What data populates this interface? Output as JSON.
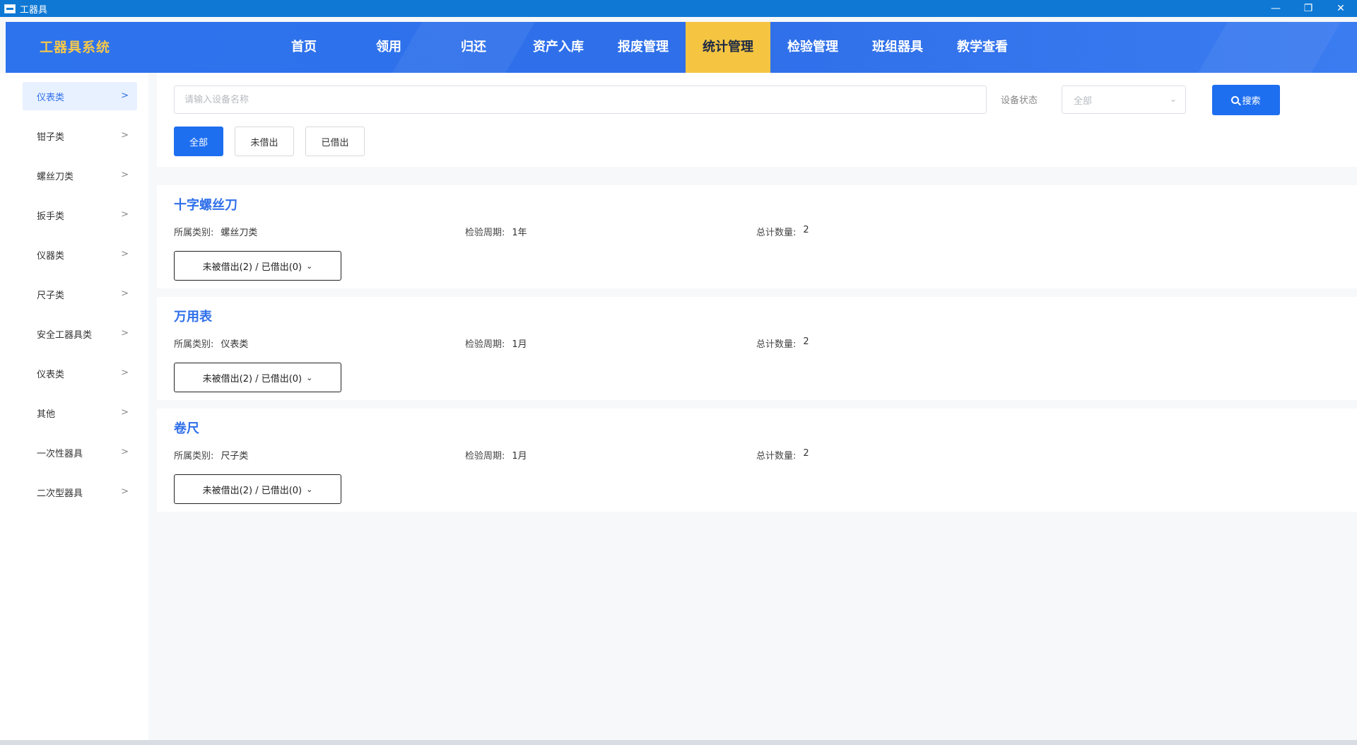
{
  "window": {
    "title": "工器具",
    "controls": [
      "minimize-icon",
      "restore-icon",
      "close-icon"
    ]
  },
  "navbar": {
    "brand": "工器具系统",
    "menu": [
      {
        "label": "首页"
      },
      {
        "label": "领用"
      },
      {
        "label": "归还"
      },
      {
        "label": "资产入库"
      },
      {
        "label": "报废管理"
      },
      {
        "label": "统计管理",
        "active": true
      },
      {
        "label": "检验管理"
      },
      {
        "label": "班组器具"
      },
      {
        "label": "教学查看"
      }
    ]
  },
  "sidebar": {
    "items": [
      {
        "label": "仪表类",
        "active": true
      },
      {
        "label": "钳子类"
      },
      {
        "label": "螺丝刀类"
      },
      {
        "label": "扳手类"
      },
      {
        "label": "仪器类"
      },
      {
        "label": "尺子类"
      },
      {
        "label": "安全工器具类"
      },
      {
        "label": "仪表类"
      },
      {
        "label": "其他"
      },
      {
        "label": "一次性器具"
      },
      {
        "label": "二次型器具"
      }
    ]
  },
  "filter": {
    "search_placeholder": "请输入设备名称",
    "search_value": "",
    "status_label": "设备状态",
    "status_value": "全部",
    "search_button": "搜索",
    "segments": [
      {
        "label": "全部",
        "active": true
      },
      {
        "label": "未借出"
      },
      {
        "label": "已借出"
      }
    ]
  },
  "cards": [
    {
      "title": "十字螺丝刀",
      "category_key": "所属类别:",
      "category_value": "螺丝刀类",
      "cycle_key": "检验周期:",
      "cycle_value": "1年",
      "count_key": "总计数量:",
      "count_value": "2",
      "dropdown": "未被借出(2) / 已借出(0)"
    },
    {
      "title": "万用表",
      "category_key": "所属类别:",
      "category_value": "仪表类",
      "cycle_key": "检验周期:",
      "cycle_value": "1月",
      "count_key": "总计数量:",
      "count_value": "2",
      "dropdown": "未被借出(2) / 已借出(0)"
    },
    {
      "title": "卷尺",
      "category_key": "所属类别:",
      "category_value": "尺子类",
      "cycle_key": "检验周期:",
      "cycle_value": "1月",
      "count_key": "总计数量:",
      "count_value": "2",
      "dropdown": "未被借出(2) / 已借出(0)"
    }
  ],
  "colors": {
    "primary": "#1e6ff0",
    "nav_bg": "#2f6fe9",
    "nav_active": "#f5c542",
    "brand": "#f5c84b",
    "titlebar": "#0e78d4"
  }
}
